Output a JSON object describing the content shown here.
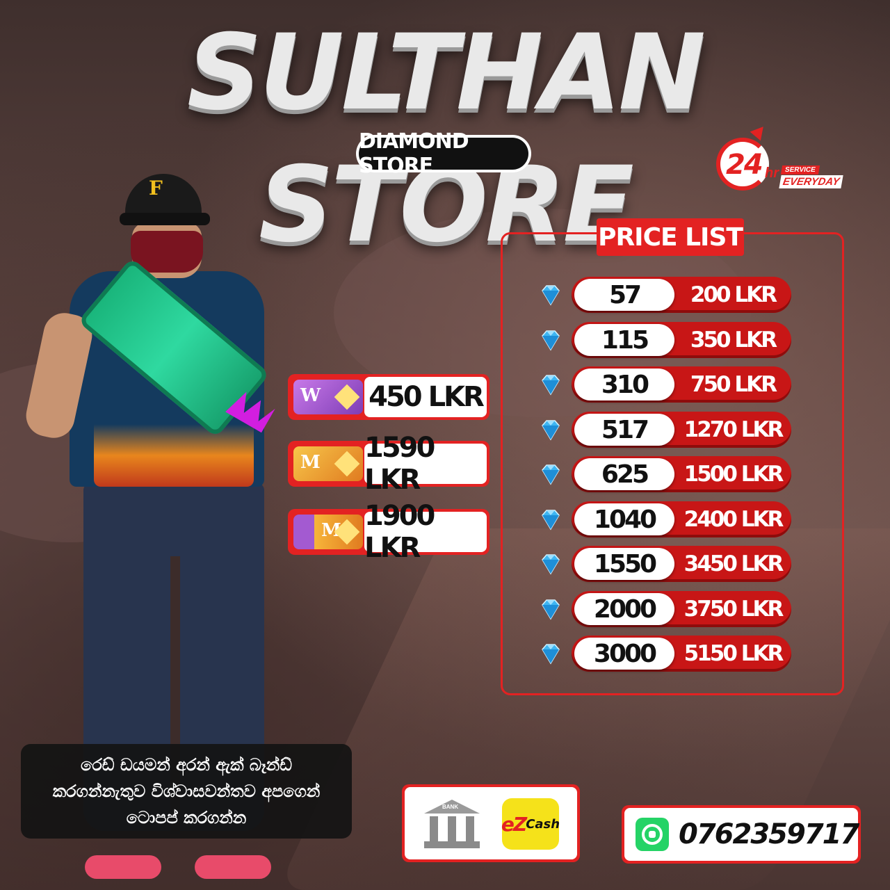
{
  "header": {
    "title": "SULTHAN STORE",
    "subtitle": "DIAMOND STORE"
  },
  "badge": {
    "number": "24",
    "unit": "hr",
    "service": "SERVICE",
    "everyday": "EVERYDAY"
  },
  "cap_letter": "F",
  "bundles": [
    {
      "icon": "weekly-membership-icon",
      "letter": "W",
      "price": "450 LKR"
    },
    {
      "icon": "monthly-membership-icon",
      "letter": "M",
      "price": "1590 LKR"
    },
    {
      "icon": "combo-membership-icon",
      "letter": "M",
      "price": "1900 LKR"
    }
  ],
  "price_list": {
    "heading": "PRICE LIST",
    "rows": [
      {
        "diamonds": "57",
        "price": "200 LKR"
      },
      {
        "diamonds": "115",
        "price": "350 LKR"
      },
      {
        "diamonds": "310",
        "price": "750 LKR"
      },
      {
        "diamonds": "517",
        "price": "1270 LKR"
      },
      {
        "diamonds": "625",
        "price": "1500 LKR"
      },
      {
        "diamonds": "1040",
        "price": "2400 LKR"
      },
      {
        "diamonds": "1550",
        "price": "3450 LKR"
      },
      {
        "diamonds": "2000",
        "price": "3750 LKR"
      },
      {
        "diamonds": "3000",
        "price": "5150 LKR"
      }
    ]
  },
  "note": {
    "line1": "රෙඩ් ඩයමන් අරන් ඇක් බෑන්ඩ්",
    "line2": "කරගන්නැතුව විශ්වාසවන්තව අපගෙන්",
    "line3": "ටොපප් කරගන්න"
  },
  "payment": {
    "bank_label": "BANK",
    "ezcash_ez": "eZ",
    "ezcash_cash": "Cash"
  },
  "contact": {
    "phone": "0762359717"
  },
  "colors": {
    "accent": "#e32222",
    "whatsapp": "#25d366",
    "ezcash": "#f5e21a"
  }
}
